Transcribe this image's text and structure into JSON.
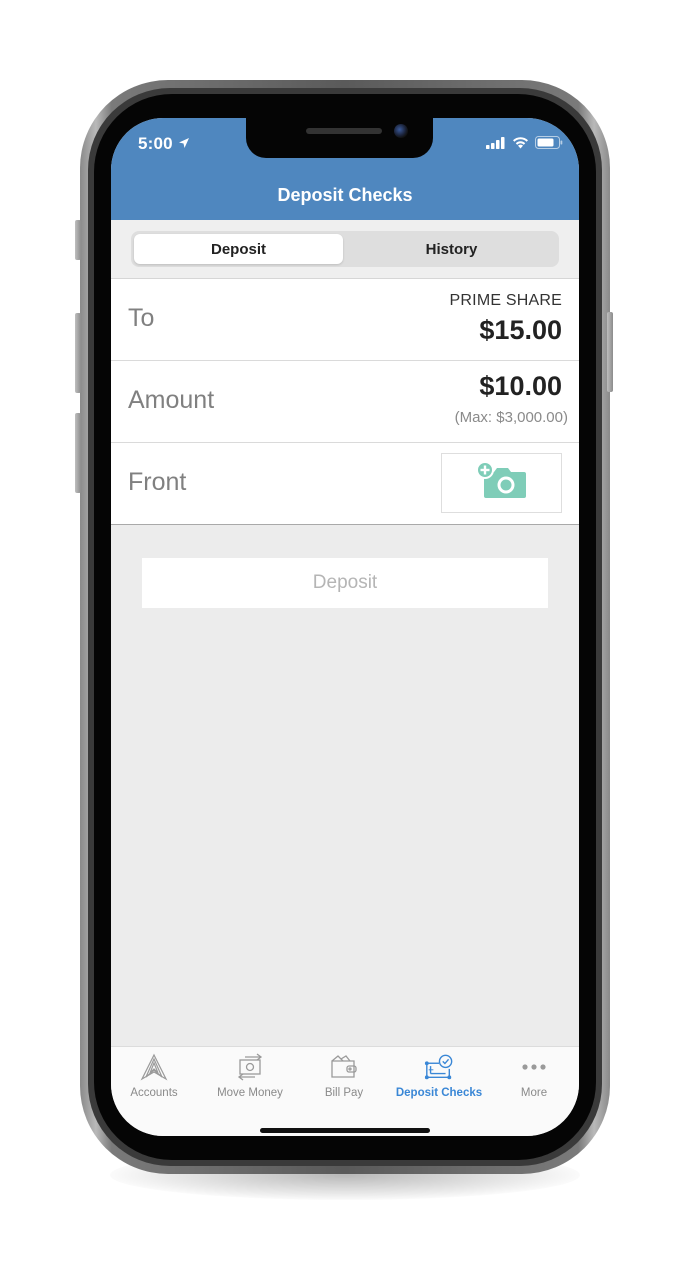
{
  "status_bar": {
    "time": "5:00",
    "location_icon": "location-arrow-icon",
    "signal_icon": "cellular-signal-icon",
    "wifi_icon": "wifi-icon",
    "battery_icon": "battery-icon"
  },
  "header": {
    "title": "Deposit Checks",
    "background_color": "#4f87bf"
  },
  "segmented_control": {
    "tabs": [
      {
        "label": "Deposit",
        "selected": true
      },
      {
        "label": "History",
        "selected": false
      }
    ]
  },
  "form": {
    "to": {
      "label": "To",
      "account_name": "PRIME SHARE",
      "account_balance": "$15.00"
    },
    "amount": {
      "label": "Amount",
      "value": "$10.00",
      "max_note": "(Max: $3,000.00)"
    },
    "front": {
      "label": "Front",
      "photo_icon": "add-photo-camera-icon",
      "icon_color": "#7fcdb8"
    }
  },
  "deposit_button": {
    "label": "Deposit",
    "enabled": false
  },
  "tab_bar": {
    "active_color": "#3a87d6",
    "items": [
      {
        "label": "Accounts",
        "icon": "accounts-logo-icon",
        "active": false
      },
      {
        "label": "Move Money",
        "icon": "move-money-icon",
        "active": false
      },
      {
        "label": "Bill Pay",
        "icon": "wallet-icon",
        "active": false
      },
      {
        "label": "Deposit Checks",
        "icon": "deposit-check-icon",
        "active": true
      },
      {
        "label": "More",
        "icon": "more-dots-icon",
        "active": false
      }
    ]
  }
}
